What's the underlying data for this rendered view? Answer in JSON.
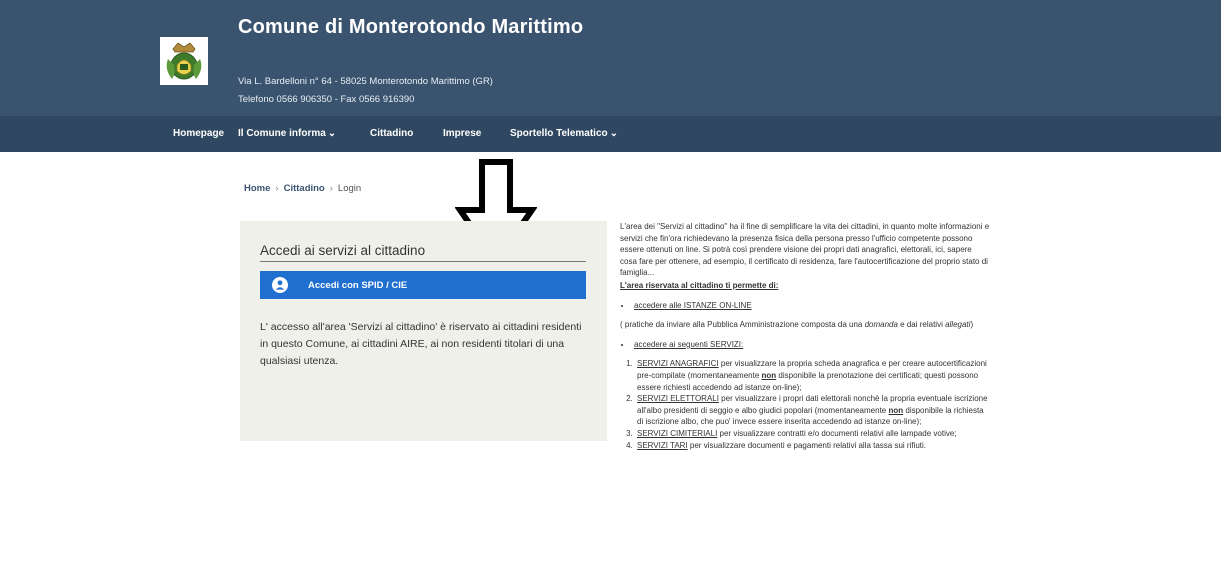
{
  "header": {
    "title": "Comune di Monterotondo Marittimo",
    "address": "Via L. Bardelloni n° 64 - 58025 Monterotondo Marittimo (GR)",
    "phone": "Telefono 0566 906350 - Fax 0566 916390"
  },
  "nav": {
    "homepage": "Homepage",
    "comune": "Il Comune informa",
    "cittadino": "Cittadino",
    "imprese": "Imprese",
    "sportello": "Sportello Telematico"
  },
  "breadcrumb": {
    "home": "Home",
    "cittadino": "Cittadino",
    "current": "Login",
    "separator": "›"
  },
  "login_card": {
    "title": "Accedi ai servizi al cittadino",
    "spid_button": "Accedi con SPID / CIE",
    "description": "L' accesso all'area 'Servizi al cittadino' è riservato ai cittadini residenti in questo Comune, ai cittadini AIRE, ai non residenti titolari di una qualsiasi utenza."
  },
  "info": {
    "intro": "L'area dei \"Servizi al cittadino\" ha il fine di semplificare la vita dei cittadini, in quanto molte informazioni e servizi che fin'ora richiedevano la presenza fisica della persona presso l'ufficio competente possono essere ottenuti on line. Si potrà così prendere visione dei propri dati anagrafici, elettorali, ici, sapere cosa fare per ottenere, ad esempio, il certificato di residenza, fare l'autocertificazione del proprio stato di famiglia...",
    "heading": "L'area riservata al cittadino ti permette di:",
    "istanze_link": "accedere alle ISTANZE ON-LINE",
    "pratiche_a": "( pratiche da inviare alla Pubblica Amministrazione composta da una ",
    "pratiche_domanda": "domanda",
    "pratiche_b": " e dai relativi ",
    "pratiche_allegati": "allegati",
    "pratiche_c": ")",
    "servizi_link": "accedere ai seguenti SERVIZI:",
    "item1_link": "SERVIZI ANAGRAFICI",
    "item1_a": " per visualizzare la propria scheda anagrafica e per creare autocertificazioni pre-compilate (momentaneamente ",
    "item1_non": "non",
    "item1_b": " disponibile la prenotazione dei certificati; questi possono essere richiesti accedendo ad istanze on-line);",
    "item2_link": "SERVIZI ELETTORALI",
    "item2_a": " per visualizzare i propri dati elettorali nonchè la propria eventuale iscrizione all'albo presidenti di seggio e albo giudici popolari (momentaneamente ",
    "item2_non": "non",
    "item2_b": " disponibile la richiesta di iscrizione albo, che puo' invece essere inserita accedendo ad istanze on-line);",
    "item3_link": "SERVIZI CIMITERIALI",
    "item3_a": " per visualizzare contratti e/o documenti relativi alle lampade votive;",
    "item4_link": "SERVIZI TARI",
    "item4_a": " per visualizzare documenti e pagamenti relativi alla tassa sui rifiuti."
  },
  "colors": {
    "header_bg": "#3a5470",
    "nav_bg": "#2f4760",
    "spid_button": "#1f6fd1",
    "card_bg": "#f0f0eb"
  }
}
